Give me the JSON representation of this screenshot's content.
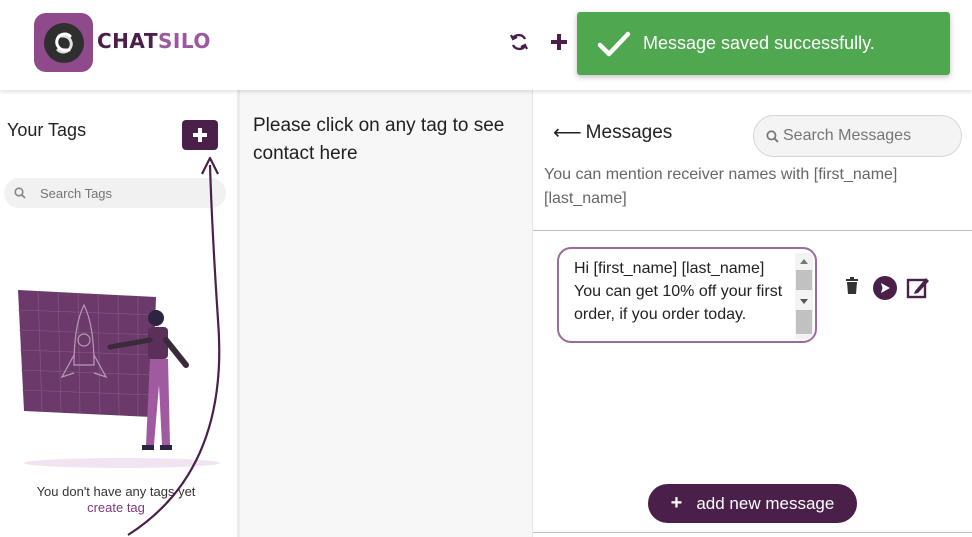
{
  "app": {
    "brand_part1": "CHAT",
    "brand_part2": "SILO"
  },
  "header": {
    "refresh_icon": "refresh-icon",
    "add_icon": "plus-icon"
  },
  "toast": {
    "text": "Message saved successfully.",
    "icon": "check-icon",
    "color": "#4fa84f"
  },
  "tags": {
    "title": "Your Tags",
    "search_placeholder": "Search Tags",
    "empty_text": "You don't have any tags yet",
    "create_link": "create tag"
  },
  "contacts": {
    "instruction": "Please click on any tag to see contact here"
  },
  "messages": {
    "title": "Messages",
    "search_placeholder": "Search Messages",
    "mention_note": "You can mention receiver names with [first_name] [last_name]",
    "items": [
      {
        "text": "Hi [first_name] [last_name] You can get 10% off your first order, if you order today."
      }
    ],
    "add_label": "add new message"
  },
  "colors": {
    "brand": "#4a1f4a",
    "accent": "#9b57a0",
    "success": "#4fa84f"
  }
}
